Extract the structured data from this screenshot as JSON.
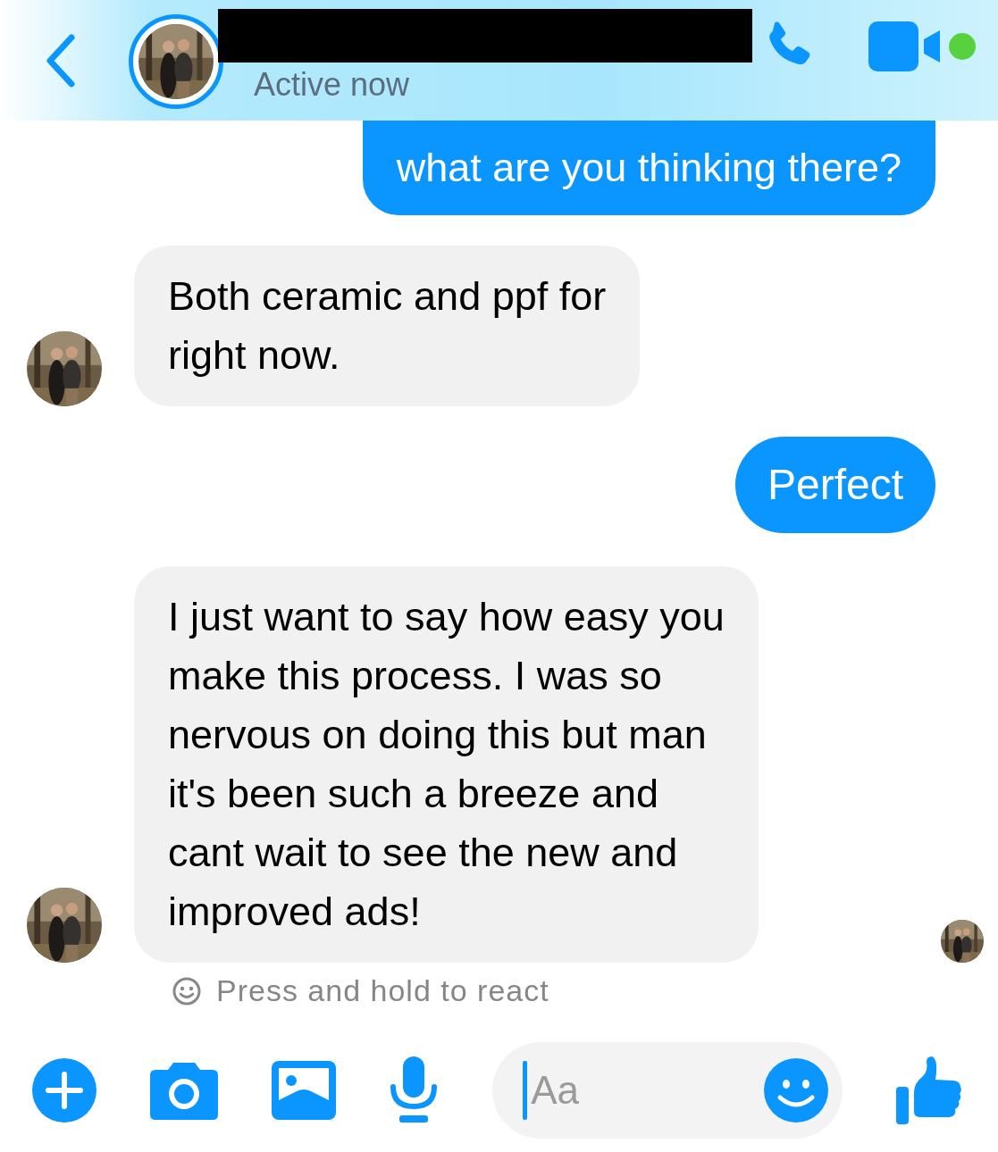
{
  "header": {
    "status": "Active now",
    "online": true,
    "name_redacted": true
  },
  "messages": [
    {
      "kind": "sent",
      "lines": [
        "what are you thinking there?"
      ]
    },
    {
      "kind": "received",
      "lines": [
        "Both ceramic and ppf for",
        "right now."
      ],
      "avatar": true
    },
    {
      "kind": "sent",
      "lines": [
        "Perfect"
      ]
    },
    {
      "kind": "received",
      "lines": [
        "I just want to say how easy you",
        "make this process. I was so",
        "nervous on doing this but man",
        "it's been such a breeze and",
        "cant wait to see the new and",
        "improved ads!"
      ],
      "avatar": true
    }
  ],
  "read_receipt": true,
  "react_hint": "Press and hold to react",
  "composer": {
    "placeholder": "Aa"
  }
}
